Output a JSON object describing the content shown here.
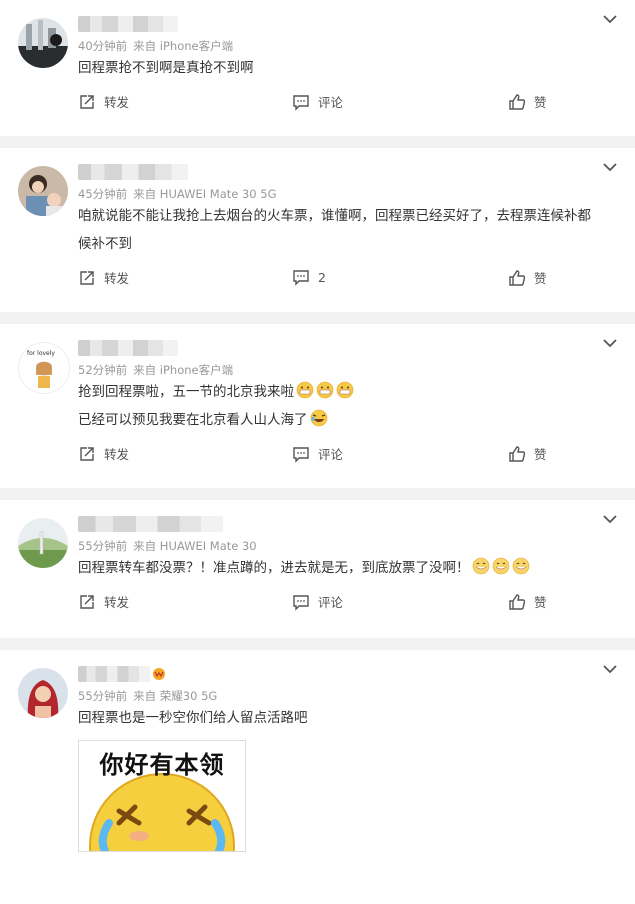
{
  "posts": [
    {
      "time": "40分钟前",
      "source": "来自 iPhone客户端",
      "text": [
        "回程票抢不到啊是真抢不到啊"
      ],
      "repost": "转发",
      "comment": "评论",
      "like": "赞"
    },
    {
      "time": "45分钟前",
      "source": "来自 HUAWEI Mate 30 5G",
      "text": [
        "咱就说能不能让我抢上去烟台的火车票，谁懂啊，回程票已经买好了，去程票连候补都",
        "候补不到"
      ],
      "repost": "转发",
      "comment": "2",
      "like": "赞"
    },
    {
      "time": "52分钟前",
      "source": "来自 iPhone客户端",
      "text": [
        "抢到回程票啦，五一节的北京我来啦",
        "已经可以预见我要在北京看人山人海了"
      ],
      "repost": "转发",
      "comment": "评论",
      "like": "赞"
    },
    {
      "time": "55分钟前",
      "source": "来自 HUAWEI Mate 30",
      "text": [
        "回程票转车都没票？！准点蹲的，进去就是无，到底放票了没啊！"
      ],
      "repost": "转发",
      "comment": "评论",
      "like": "赞"
    },
    {
      "time": "55分钟前",
      "source": "来自 荣耀30 5G",
      "text": [
        "回程票也是一秒空你们给人留点活路吧"
      ],
      "sticker_text": "你好有本领"
    }
  ],
  "icons": {
    "chevron": "chevron-down-icon",
    "repost": "share-icon",
    "comment": "comment-icon",
    "like": "thumb-up-icon"
  }
}
